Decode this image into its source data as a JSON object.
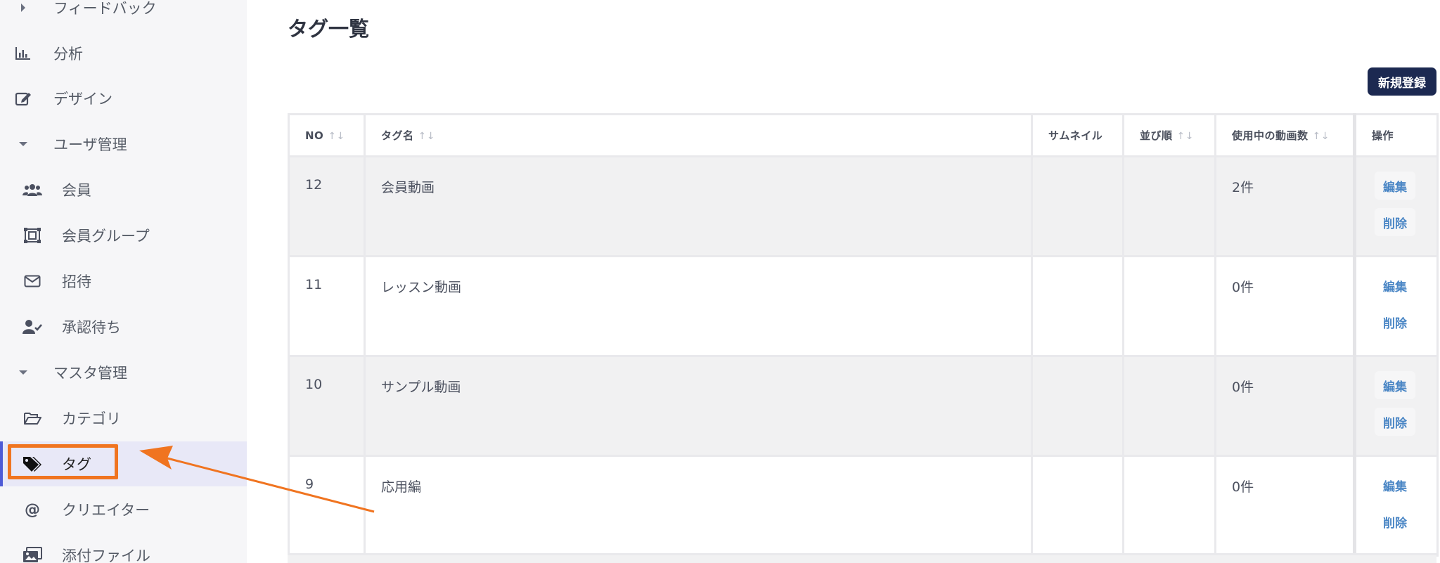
{
  "sidebar": {
    "items": [
      {
        "label": "フィードバック",
        "icon": "caret-right-icon"
      },
      {
        "label": "分析",
        "icon": "bar-chart-icon"
      },
      {
        "label": "デザイン",
        "icon": "edit-icon"
      },
      {
        "label": "ユーザ管理",
        "icon": "caret-down-icon"
      },
      {
        "label": "会員",
        "icon": "users-icon"
      },
      {
        "label": "会員グループ",
        "icon": "group-icon"
      },
      {
        "label": "招待",
        "icon": "envelope-icon"
      },
      {
        "label": "承認待ち",
        "icon": "user-check-icon"
      },
      {
        "label": "マスタ管理",
        "icon": "caret-down-icon"
      },
      {
        "label": "カテゴリ",
        "icon": "folder-open-icon"
      },
      {
        "label": "タグ",
        "icon": "tags-icon",
        "active": true
      },
      {
        "label": "クリエイター",
        "icon": "at-icon"
      },
      {
        "label": "添付ファイル",
        "icon": "images-icon"
      }
    ]
  },
  "page": {
    "title": "タグ一覧",
    "new_button": "新規登録"
  },
  "table": {
    "headers": {
      "no": "NO",
      "name": "タグ名",
      "thumbnail": "サムネイル",
      "order": "並び順",
      "video_count": "使用中の動画数",
      "actions": "操作"
    },
    "sort_indicator": "↑↓",
    "rows": [
      {
        "no": "12",
        "name": "会員動画",
        "thumbnail": "",
        "order": "",
        "video_count": "2件",
        "edit": "編集",
        "delete": "削除"
      },
      {
        "no": "11",
        "name": "レッスン動画",
        "thumbnail": "",
        "order": "",
        "video_count": "0件",
        "edit": "編集",
        "delete": "削除"
      },
      {
        "no": "10",
        "name": "サンプル動画",
        "thumbnail": "",
        "order": "",
        "video_count": "0件",
        "edit": "編集",
        "delete": "削除"
      },
      {
        "no": "9",
        "name": "応用編",
        "thumbnail": "",
        "order": "",
        "video_count": "0件",
        "edit": "編集",
        "delete": "削除"
      }
    ]
  },
  "colors": {
    "highlight": "#f07420",
    "primary_button": "#1c2951",
    "action_link": "#4a86c5",
    "active_nav": "#e8e8f7"
  }
}
